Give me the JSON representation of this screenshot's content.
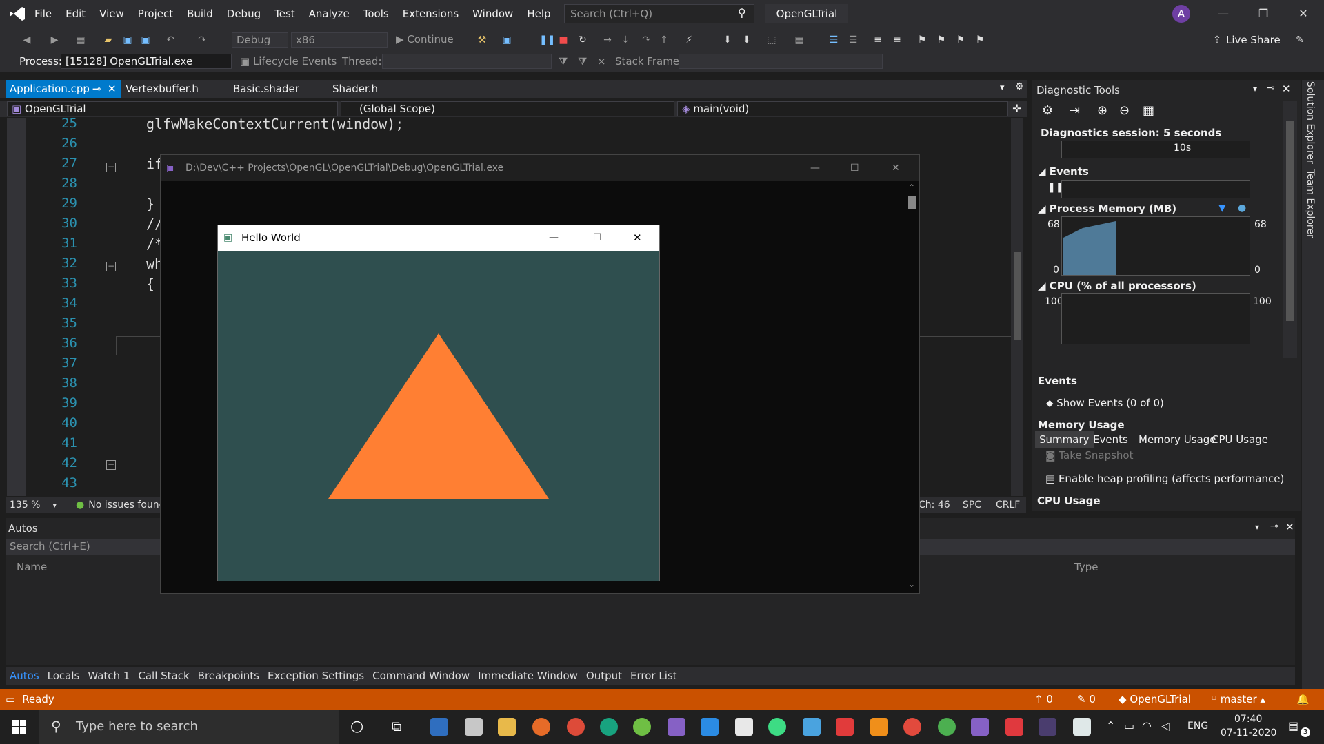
{
  "menu": [
    "File",
    "Edit",
    "View",
    "Project",
    "Build",
    "Debug",
    "Test",
    "Analyze",
    "Tools",
    "Extensions",
    "Window",
    "Help"
  ],
  "search": {
    "placeholder": "Search (Ctrl+Q)"
  },
  "solution_name": "OpenGLTrial",
  "avatar_letter": "A",
  "live_share": "Live Share",
  "toolbar": {
    "config": "Debug",
    "platform": "x86",
    "continue": "Continue"
  },
  "process_bar": {
    "process_label": "Process:",
    "process_value": "[15128] OpenGLTrial.exe",
    "lifecycle": "Lifecycle Events",
    "thread_label": "Thread:",
    "stack_label": "Stack Frame:"
  },
  "tabs": [
    "Application.cpp",
    "Vertexbuffer.h",
    "Basic.shader",
    "Shader.h"
  ],
  "nav": {
    "project": "OpenGLTrial",
    "scope": "(Global Scope)",
    "member": "main(void)"
  },
  "code_lines": [
    {
      "n": "25",
      "t": "glfwMakeContextCurrent(window);"
    },
    {
      "n": "26",
      "t": ""
    },
    {
      "n": "27",
      "t": "if"
    },
    {
      "n": "28",
      "t": ""
    },
    {
      "n": "29",
      "t": "}"
    },
    {
      "n": "30",
      "t": "//"
    },
    {
      "n": "31",
      "t": "/*"
    },
    {
      "n": "32",
      "t": "wh"
    },
    {
      "n": "33",
      "t": "{"
    },
    {
      "n": "34",
      "t": ""
    },
    {
      "n": "35",
      "t": ""
    },
    {
      "n": "36",
      "t": ""
    },
    {
      "n": "37",
      "t": ""
    },
    {
      "n": "38",
      "t": ""
    },
    {
      "n": "39",
      "t": ""
    },
    {
      "n": "40",
      "t": ""
    },
    {
      "n": "41",
      "t": ""
    },
    {
      "n": "42",
      "t": ""
    },
    {
      "n": "43",
      "t": ""
    }
  ],
  "editor_status": {
    "zoom": "135 %",
    "issues": "No issues found",
    "ch": "Ch: 46",
    "spc": "SPC",
    "crlf": "CRLF"
  },
  "diag": {
    "title": "Diagnostic Tools",
    "session": "Diagnostics session: 5 seconds",
    "timeline_tick": "10s",
    "events_label": "Events",
    "memory_label": "Process Memory (MB)",
    "memory_max": "68",
    "memory_min": "0",
    "cpu_label": "CPU (% of all processors)",
    "cpu_max": "100",
    "tabs": [
      "Summary",
      "Events",
      "Memory Usage",
      "CPU Usage"
    ],
    "sec_events": "Events",
    "show_events": "Show Events (0 of 0)",
    "sec_memory": "Memory Usage",
    "take_snapshot": "Take Snapshot",
    "heap_profiling": "Enable heap profiling (affects performance)",
    "sec_cpu": "CPU Usage"
  },
  "right_sidebar": [
    "Solution Explorer",
    "Team Explorer"
  ],
  "autos": {
    "title": "Autos",
    "search": "Search (Ctrl+E)",
    "col_name": "Name",
    "col_type": "Type"
  },
  "bottom_tabs": [
    "Autos",
    "Locals",
    "Watch 1",
    "Call Stack",
    "Breakpoints",
    "Exception Settings",
    "Command Window",
    "Immediate Window",
    "Output",
    "Error List"
  ],
  "status": {
    "ready": "Ready",
    "up": "0",
    "edits": "0",
    "repo": "OpenGLTrial",
    "branch": "master"
  },
  "taskbar": {
    "search": "Type here to search",
    "lang": "ENG",
    "time": "07:40",
    "date": "07-11-2020",
    "notif": "3"
  },
  "console": {
    "title": "D:\\Dev\\C++ Projects\\OpenGL\\OpenGLTrial\\Debug\\OpenGLTrial.exe"
  },
  "hello": {
    "title": "Hello World",
    "bg": "#2f4f4f",
    "triangle_color": "#ff7f33"
  }
}
